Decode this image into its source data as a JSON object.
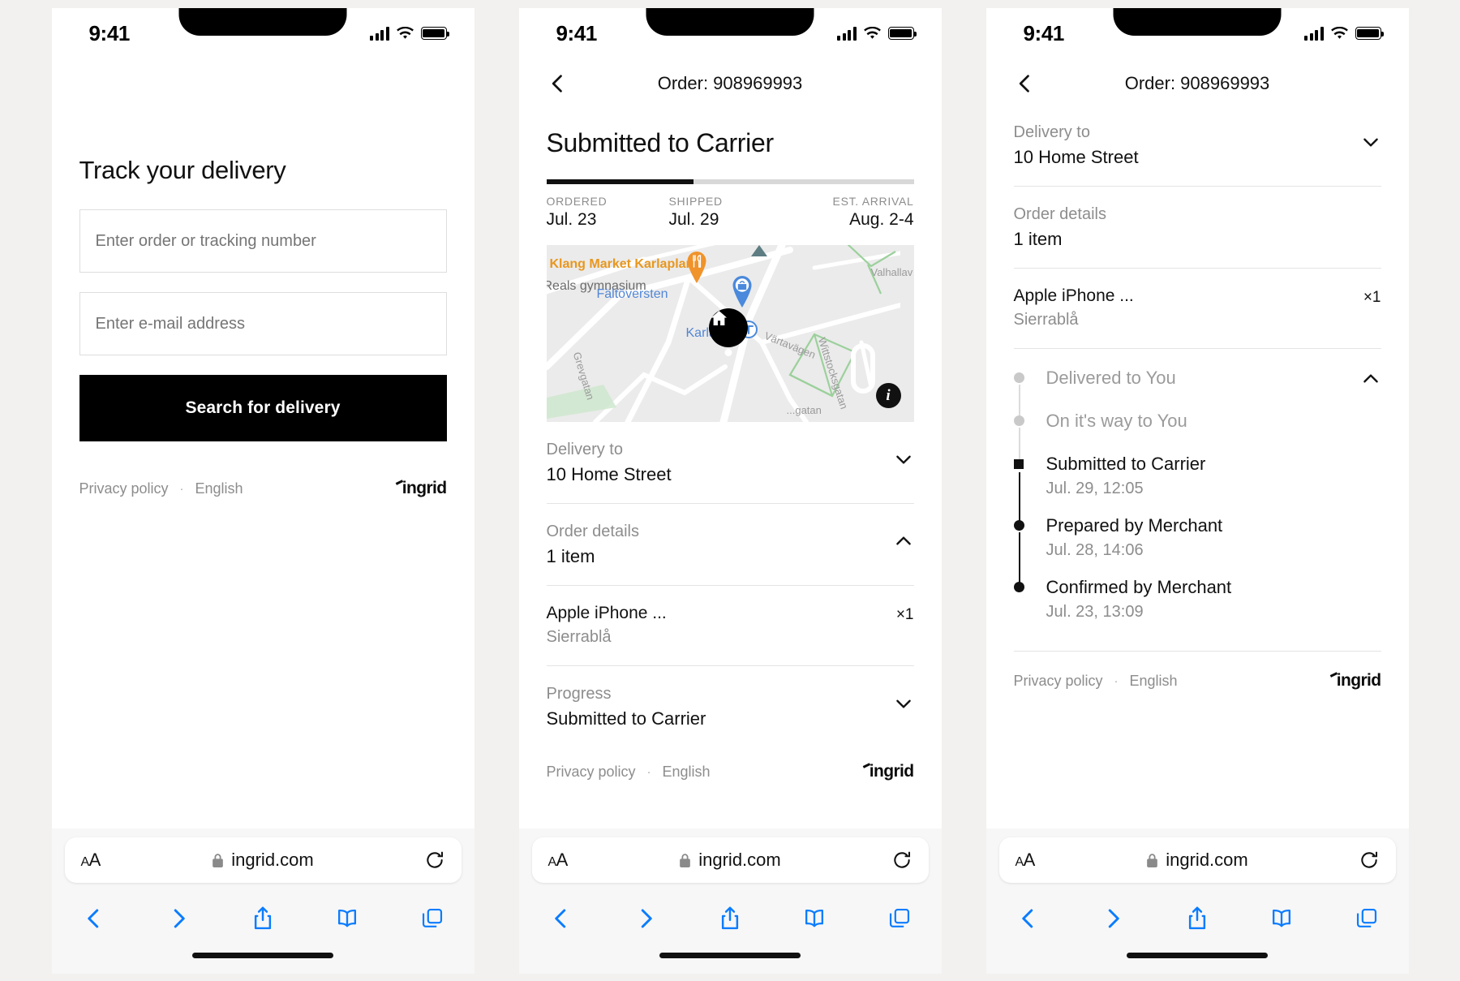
{
  "status_bar": {
    "time": "9:41"
  },
  "browser": {
    "url": "ingrid.com",
    "text_size_label": "AA",
    "lock_icon": "lock-icon",
    "reload_icon": "reload-icon",
    "back_icon": "back-icon",
    "forward_icon": "forward-icon",
    "share_icon": "share-icon",
    "bookmarks_icon": "book-icon",
    "tabs_icon": "tabs-icon"
  },
  "footer": {
    "privacy_policy": "Privacy policy",
    "separator": "·",
    "language": "English",
    "brand": "ingrid"
  },
  "panel1": {
    "title": "Track your delivery",
    "order_input_placeholder": "Enter order or tracking number",
    "order_input_value": "",
    "email_input_placeholder": "Enter e-mail address",
    "email_input_value": "",
    "search_button": "Search for delivery"
  },
  "panel2": {
    "order_label": "Order: 908969993",
    "status_title": "Submitted to Carrier",
    "progress_percent": 40,
    "milestones": [
      {
        "label": "ORDERED",
        "value": "Jul. 23"
      },
      {
        "label": "SHIPPED",
        "value": "Jul. 29"
      },
      {
        "label": "EST. ARRIVAL",
        "value": "Aug. 2-4"
      }
    ],
    "map": {
      "labels": [
        {
          "text": "Klang Market Karlaplan",
          "color": "#e8971f"
        },
        {
          "text": "Reals gymnasium",
          "color": "#6b6b6b"
        },
        {
          "text": "Fältöversten",
          "color": "#5186d6"
        },
        {
          "text": "Karlaplan",
          "color": "#5186d6"
        },
        {
          "text": "Grevgatan",
          "color": "#9a9a9a"
        },
        {
          "text": "Värtavägen",
          "color": "#9a9a9a"
        },
        {
          "text": "Wittstocksgatan",
          "color": "#9a9a9a"
        },
        {
          "text": "Valhallav",
          "color": "#9a9a9a"
        },
        {
          "text": "...gatan",
          "color": "#9a9a9a"
        }
      ],
      "home_marker": "home-marker",
      "info_button": "i"
    },
    "sections": [
      {
        "key": "Delivery to",
        "value": "10 Home Street",
        "state": "collapsed"
      },
      {
        "key": "Order details",
        "value": "1 item",
        "state": "expanded"
      },
      {
        "key": "Progress",
        "value": "Submitted to Carrier",
        "state": "collapsed"
      }
    ],
    "item": {
      "name": "Apple iPhone ...",
      "variant": "Sierrablå",
      "qty": "×1"
    }
  },
  "panel3": {
    "order_label": "Order: 908969993",
    "sections": [
      {
        "key": "Delivery to",
        "value": "10 Home Street",
        "state": "collapsed"
      },
      {
        "key": "Order details",
        "value": "1 item",
        "state": "expanded"
      }
    ],
    "item": {
      "name": "Apple iPhone ...",
      "variant": "Sierrablå",
      "qty": "×1"
    },
    "timeline_expanded": true,
    "timeline": [
      {
        "title": "Delivered to You",
        "date": "",
        "state": "pending"
      },
      {
        "title": "On it's way to You",
        "date": "",
        "state": "pending"
      },
      {
        "title": "Submitted to Carrier",
        "date": "Jul. 29, 12:05",
        "state": "current"
      },
      {
        "title": "Prepared by  Merchant",
        "date": "Jul. 28, 14:06",
        "state": "done"
      },
      {
        "title": "Confirmed by Merchant",
        "date": "Jul. 23, 13:09",
        "state": "done"
      }
    ]
  },
  "colors": {
    "accent_black": "#000000",
    "muted_text": "#8d8d8d",
    "safari_blue": "#0a7cff",
    "page_bg": "#f2f1ef",
    "map_bg": "#ebebeb",
    "divider": "#e4e4e4"
  }
}
